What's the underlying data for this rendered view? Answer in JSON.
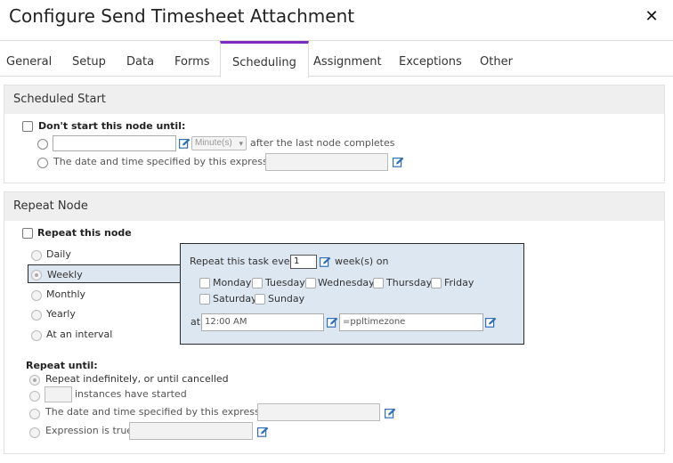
{
  "dialog": {
    "title": "Configure Send Timesheet Attachment"
  },
  "tabs": [
    "General",
    "Setup",
    "Data",
    "Forms",
    "Scheduling",
    "Assignment",
    "Exceptions",
    "Other"
  ],
  "active_tab": "Scheduling",
  "scheduled_start": {
    "heading": "Scheduled Start",
    "dont_start_label": "Don't start this node until:",
    "offset_unit": "Minute(s)",
    "after_label": "after the last node completes",
    "expression_label": "The date and time specified by this expression:"
  },
  "repeat_node": {
    "heading": "Repeat Node",
    "repeat_label": "Repeat this node",
    "options": [
      "Daily",
      "Weekly",
      "Monthly",
      "Yearly",
      "At an interval"
    ],
    "selected": "Weekly",
    "repeat_until": {
      "label": "Repeat until:",
      "indefinitely": "Repeat indefinitely, or until cancelled",
      "instances": "instances have started",
      "expression": "The date and time specified by this expression:",
      "expr_true": "Expression is true:"
    }
  },
  "weekly_popup": {
    "prefix": "Repeat this task every",
    "interval": "1",
    "suffix": "week(s) on",
    "days": [
      "Monday",
      "Tuesday",
      "Wednesday",
      "Thursday",
      "Friday",
      "Saturday",
      "Sunday"
    ],
    "at_label": "at",
    "time": "12:00 AM",
    "timezone": "=ppltimezone"
  },
  "colors": {
    "accent": "#7b2cbf",
    "popup_bg": "#dde7f1",
    "edit_icon": "#2f6fb5"
  },
  "icons": {
    "close": "close-icon",
    "edit": "edit-icon"
  }
}
